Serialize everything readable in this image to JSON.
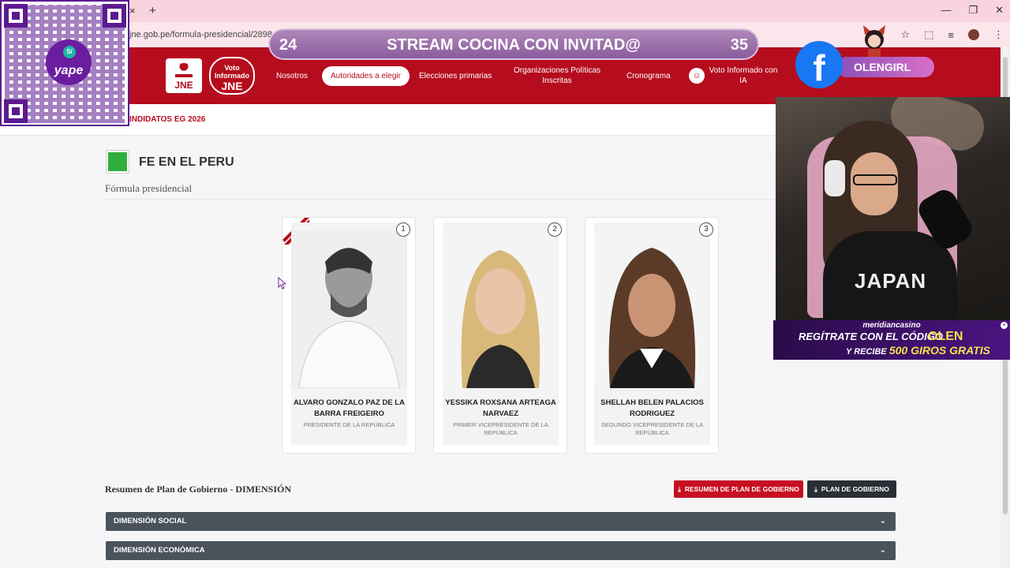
{
  "browser": {
    "url": "jne.gob.pe/formula-presidencial/2898",
    "tab_close": "×",
    "tab_new": "+",
    "win_min": "—",
    "win_restore": "❐",
    "win_close": "✕",
    "star": "☆",
    "ext": "⬚",
    "media": "≡",
    "menu": "⋮"
  },
  "nav": {
    "logo_jne": "JNE",
    "logo_voto_line1": "Voto",
    "logo_voto_line2": "Informado",
    "logo_voto_line3": "JNE",
    "items": [
      {
        "label": "Nosotros"
      },
      {
        "label": "Autoridades a elegir"
      },
      {
        "label": "Elecciones primarias"
      },
      {
        "label": "Organizaciones Políticas Inscritas"
      },
      {
        "label": "Cronograma"
      },
      {
        "label": "Voto Informado con IA"
      }
    ]
  },
  "breadcrumb": "INDIDATOS EG 2026",
  "party": {
    "name": "FE EN EL PERU",
    "subtitle": "Fórmula presidencial"
  },
  "candidates": [
    {
      "number": "1",
      "name": "ALVARO GONZALO PAZ DE LA BARRA FREIGEIRO",
      "role": "PRESIDENTE DE LA REPÚBLICA"
    },
    {
      "number": "2",
      "name": "YESSIKA ROXSANA ARTEAGA NARVAEZ",
      "role": "PRIMER VICEPRESIDENTE DE LA REPÚBLICA"
    },
    {
      "number": "3",
      "name": "SHELLAH BELEN PALACIOS RODRIGUEZ",
      "role": "SEGUNDO VICEPRESIDENTE DE LA REPÚBLICA"
    }
  ],
  "plan": {
    "title": "Resumen de Plan de Gobierno - DIMENSIÓN",
    "btn_resumen": "RESUMEN DE PLAN DE GOBIERNO",
    "btn_plan": "PLAN DE GOBIERNO",
    "sections": [
      {
        "label": "DIMENSIÓN SOCIAL"
      },
      {
        "label": "DIMENSIÓN ECONÓMICA"
      }
    ]
  },
  "stream": {
    "banner_left": "24",
    "banner_center": "STREAM COCINA CON INVITAD@",
    "banner_right": "35",
    "fb_handle": "OLENGIRL",
    "yape_label": "yape",
    "yape_currency": "S/",
    "promo_brand": "meridiancasino",
    "promo_line1": "REGÍTRATE CON EL CÓDIGO",
    "promo_code": "OLEN",
    "promo_line2": "Y RECIBE",
    "promo_highlight": "500 GIROS GRATIS",
    "cam_shirt_text": "JAPAN"
  },
  "colors": {
    "brand_red": "#b50d1e",
    "accordion": "#4a525c",
    "button_dark": "#2a2f36",
    "party_green": "#2fae3e"
  }
}
